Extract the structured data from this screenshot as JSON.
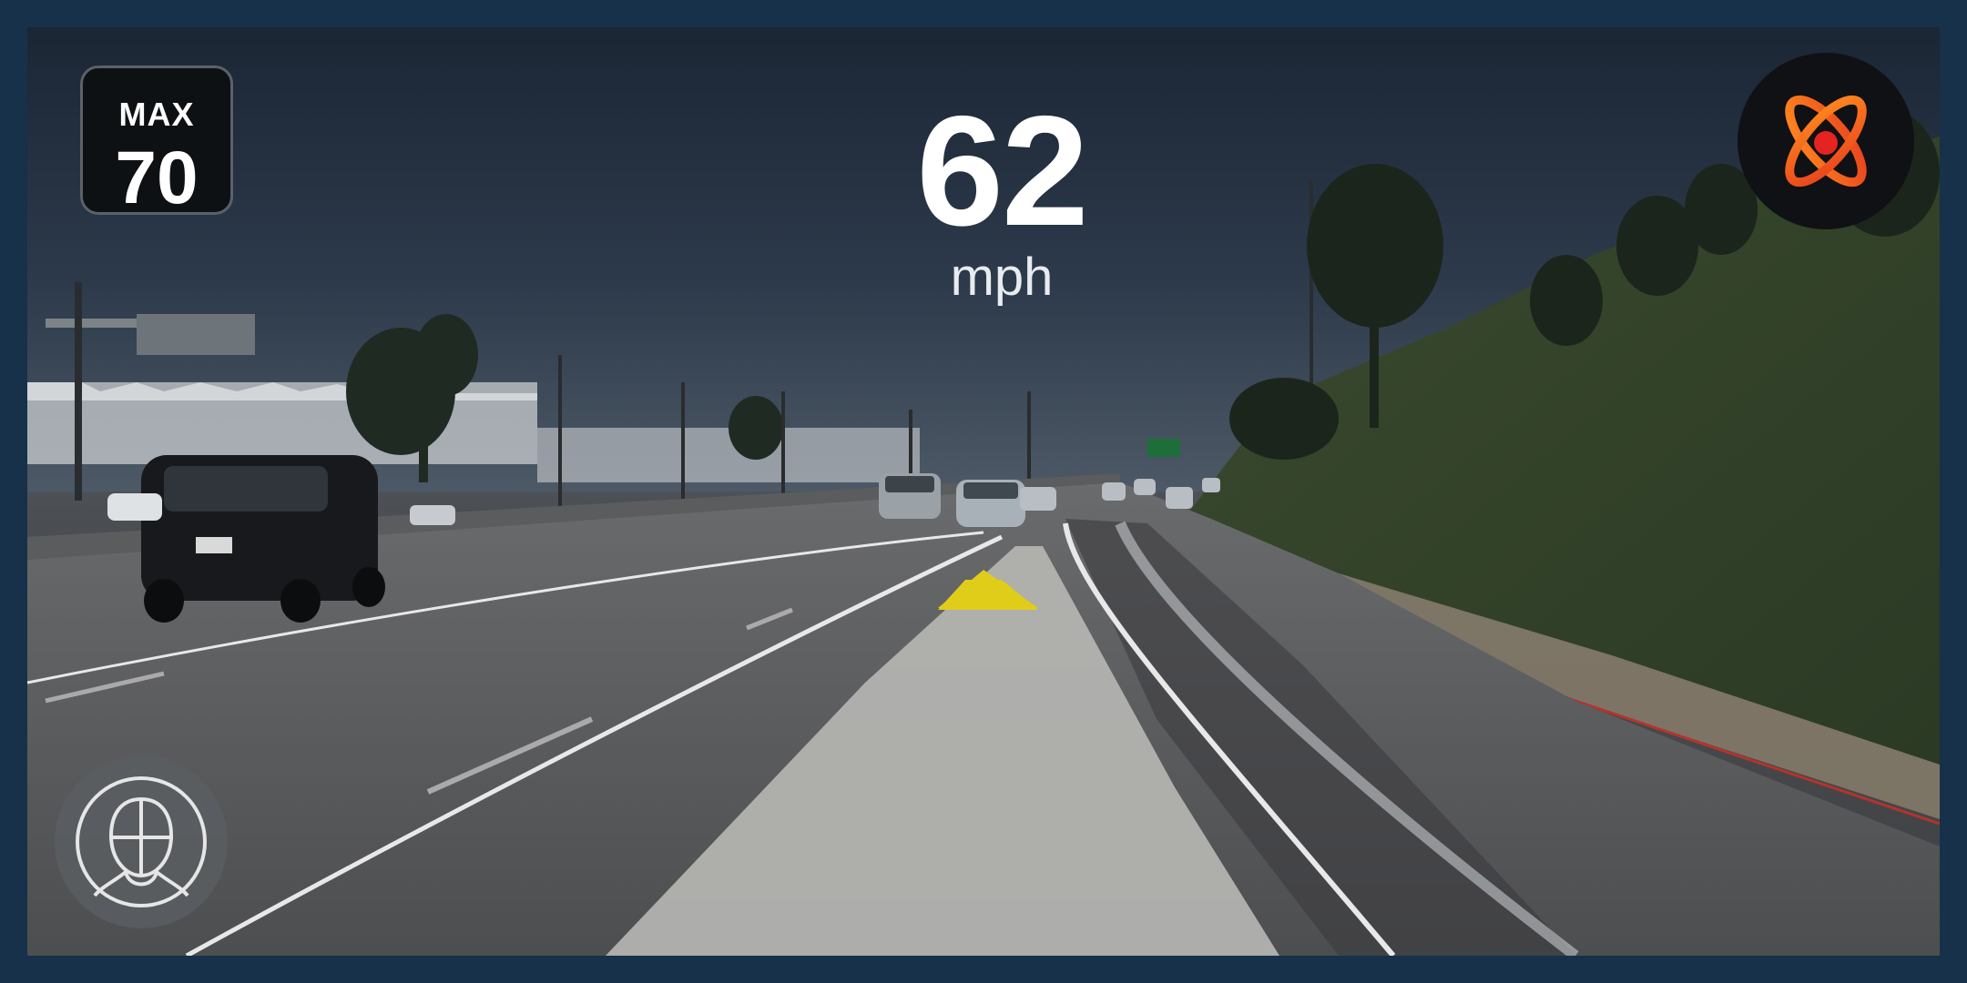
{
  "speed_limit": {
    "label": "MAX",
    "value": "70"
  },
  "speedometer": {
    "value": "62",
    "unit": "mph"
  },
  "icons": {
    "autopilot": "atom-icon",
    "driver_monitor": "driver-face-icon",
    "path_arrow": "triangle-up-icon"
  },
  "colors": {
    "frame": "#163149",
    "path": "#b5b5b1",
    "arrow": "#e0cd19",
    "autopilot_gradient": [
      "#ff7a1a",
      "#e8411d"
    ],
    "autopilot_dot": "#e52321"
  }
}
